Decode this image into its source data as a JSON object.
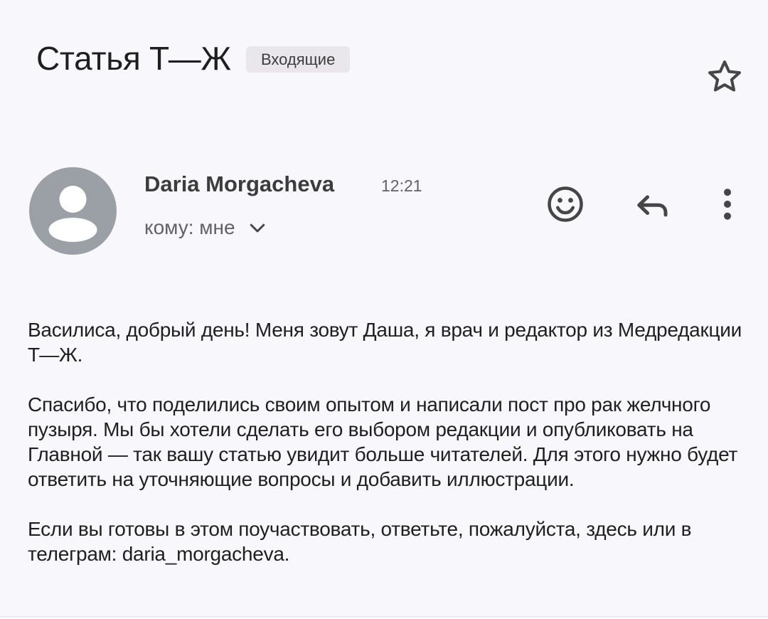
{
  "message": {
    "subject": "Статья Т—Ж",
    "label": "Входящие",
    "sender_name": "Daria Morgacheva",
    "time": "12:21",
    "recipient": "кому: мне"
  },
  "actions": {
    "star": "star-icon",
    "emoji": "add-reaction-icon",
    "reply": "reply-icon",
    "more": "more-vert-icon"
  },
  "body": {
    "paragraphs": [
      "Василиса, добрый день! Меня зовут Даша, я врач и редактор из Медредакции Т—Ж.",
      "Спасибо, что поделились своим опытом и написали пост про рак желчного пузыря. Мы бы хотели сделать его выбором редакции и опубликовать на Главной — так вашу статью увидит больше читателей. Для этого нужно будет ответить на уточняющие вопросы и добавить иллюстрации.",
      "Если вы готовы в этом поучаствовать, ответьте, пожалуйста, здесь или в телеграм: daria_morgacheva."
    ]
  },
  "colors": {
    "background": "#f8f7fb",
    "avatar": "#9aa0a6",
    "icon": "#444746",
    "chip": "#e9e7ec"
  }
}
